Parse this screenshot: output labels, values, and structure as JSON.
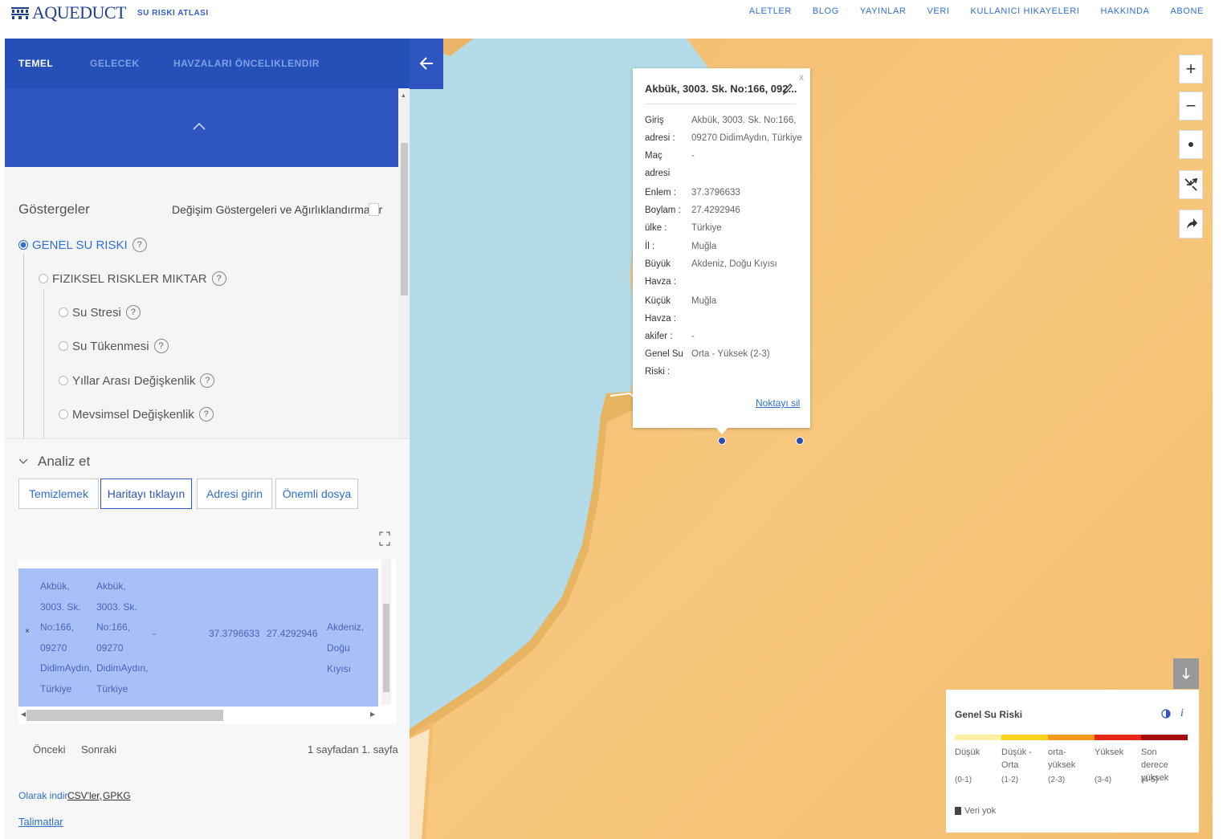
{
  "header": {
    "logo_text": "AQUEDUCT",
    "logo_subtitle": "SU RISKI ATLASI",
    "nav": [
      "ALETLER",
      "BLOG",
      "YAYINLAR",
      "VERI",
      "KULLANICI HIKAYELERI",
      "HAKKINDA",
      "ABONE"
    ]
  },
  "sidebar": {
    "tabs": [
      {
        "label": "TEMEL",
        "active": true
      },
      {
        "label": "GELECEK",
        "active": false
      },
      {
        "label": "HAVZALARI ÖNCELIKLENDIR",
        "active": false
      }
    ],
    "indicators_title": "Göstergeler",
    "change_indicators_label": "Değişim Göstergeleri ve Ağırlıklandırmalar",
    "options": [
      {
        "label": "GENEL SU RISKI",
        "selected": true
      },
      {
        "label": "FIZIKSEL RISKLER MIKTAR",
        "selected": false
      },
      {
        "label": "Su Stresi",
        "selected": false
      },
      {
        "label": "Su Tükenmesi",
        "selected": false
      },
      {
        "label": "Yıllar Arası Değişkenlik",
        "selected": false
      },
      {
        "label": "Mevsimsel Değişkenlik",
        "selected": false
      }
    ],
    "help_glyph": "?"
  },
  "analyze": {
    "title": "Analiz et",
    "buttons": [
      "Temizlemek",
      "Haritayı tıklayın",
      "Adresi girin",
      "Önemli dosya"
    ],
    "table_row": {
      "remove": "×",
      "input_address": [
        "Akbük,",
        "3003. Sk.",
        "No:166,",
        "09270",
        "DidimAydın,",
        "Türkiye"
      ],
      "match_address": [
        "Akbük,",
        "3003. Sk.",
        "No:166,",
        "09270",
        "DidimAydın,",
        "Türkiye"
      ],
      "aquifer": "-",
      "lat": "37.3796633",
      "lon": "27.4292946",
      "major_basin": [
        "Akdeniz,",
        "Doğu Kıyısı"
      ]
    },
    "pagination": {
      "prev": "Önceki",
      "next": "Sonraki",
      "info": "1 sayfadan 1. sayfa"
    },
    "download_label": "Olarak indir",
    "download_csv": "CSV'ler,",
    "download_gpkg": "GPKG",
    "instructions": "Talimatlar"
  },
  "map_controls": {
    "zoom_in": "+",
    "zoom_out": "−"
  },
  "popup": {
    "title": "Akbük, 3003. Sk. No:166, 092...",
    "close": "x",
    "fields": [
      {
        "label": [
          "Giriş",
          "adresi :"
        ],
        "value": [
          "Akbük, 3003. Sk. No:166,",
          "09270 DidimAydın, Türkiye"
        ]
      },
      {
        "label": [
          "Maç adresi",
          ":"
        ],
        "value": [
          "-"
        ]
      },
      {
        "label": [
          "Enlem :"
        ],
        "value": [
          "37.3796633"
        ]
      },
      {
        "label": [
          "Boylam :"
        ],
        "value": [
          "27.4292946"
        ]
      },
      {
        "label": [
          "ülke :"
        ],
        "value": [
          "Türkiye"
        ]
      },
      {
        "label": [
          "İl :"
        ],
        "value": [
          "Muğla"
        ]
      },
      {
        "label": [
          "Büyük",
          "Havza :"
        ],
        "value": [
          "Akdeniz, Doğu Kıyısı"
        ]
      },
      {
        "label": [
          "Küçük",
          "Havza :"
        ],
        "value": [
          "Muğla"
        ]
      },
      {
        "label": [
          "akifer :"
        ],
        "value": [
          "-"
        ]
      },
      {
        "label": [
          "Genel Su",
          "Riski :"
        ],
        "value": [
          "Orta - Yüksek (2-3)"
        ]
      }
    ],
    "remove_link": "Noktayı sil"
  },
  "legend": {
    "title": "Genel Su Riski",
    "categories": [
      {
        "label": "Düşük",
        "range": "(0-1)",
        "color": "#fff0a8"
      },
      {
        "label": "Düşük - Orta",
        "range": "(1-2)",
        "color": "#f8d21c"
      },
      {
        "label": "orta-yüksek",
        "range": "(2-3)",
        "color": "#f59a1e"
      },
      {
        "label": "Yüksek",
        "range": "(3-4)",
        "color": "#e8261a"
      },
      {
        "label": "Son derece yüksek",
        "range": "(4-5)",
        "color": "#a80c10"
      }
    ],
    "no_data": "Veri yok",
    "info_glyph": "i"
  },
  "colors": {
    "brand_blue": "#2550b8",
    "link_blue": "#2f6fd0",
    "water": "#b3dbe8",
    "land_risk": "#f5c376"
  }
}
